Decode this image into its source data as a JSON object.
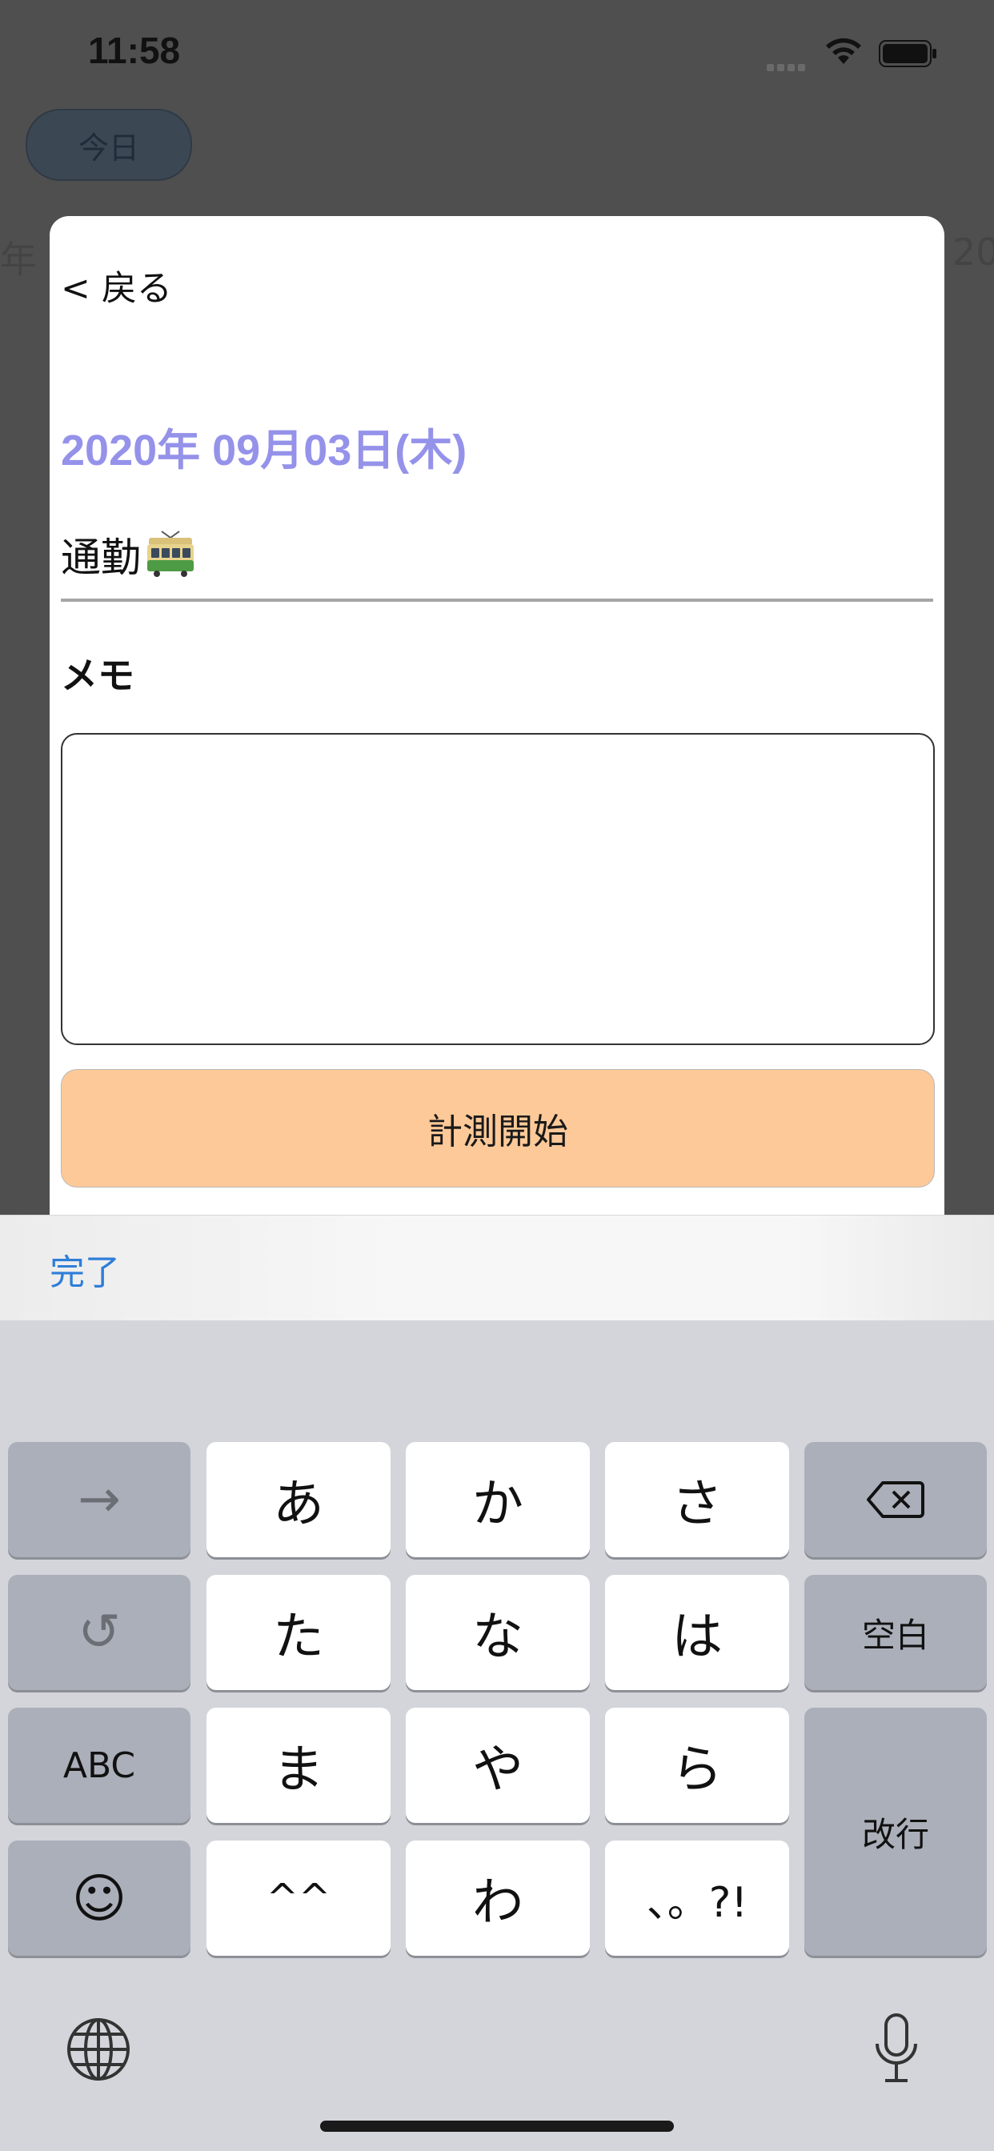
{
  "status_bar": {
    "time": "11:58"
  },
  "background": {
    "today_button": "今日",
    "year_left": "年",
    "year_right": "20"
  },
  "modal": {
    "back_label": "< 戻る",
    "date_title": "2020年 09月03日(木)",
    "title_text": "通勤",
    "title_icon": "tram-icon",
    "memo_label": "メモ",
    "memo_value": "",
    "start_button": "計測開始"
  },
  "accessory": {
    "done_label": "完了"
  },
  "keyboard": {
    "rows": [
      [
        "→",
        "あ",
        "か",
        "さ",
        "⌫"
      ],
      [
        "↺",
        "た",
        "な",
        "は",
        "空白"
      ],
      [
        "ABC",
        "ま",
        "や",
        "ら",
        "改行"
      ],
      [
        "☺",
        "^^",
        "わ",
        "、。?!"
      ]
    ],
    "colors": {
      "light_key": "#ffffff",
      "dark_key": "#abafb9",
      "background": "#d3d5da"
    }
  },
  "colors": {
    "accent_date": "#9592ea",
    "start_button": "#fec998",
    "done_link": "#2f7ed8"
  }
}
